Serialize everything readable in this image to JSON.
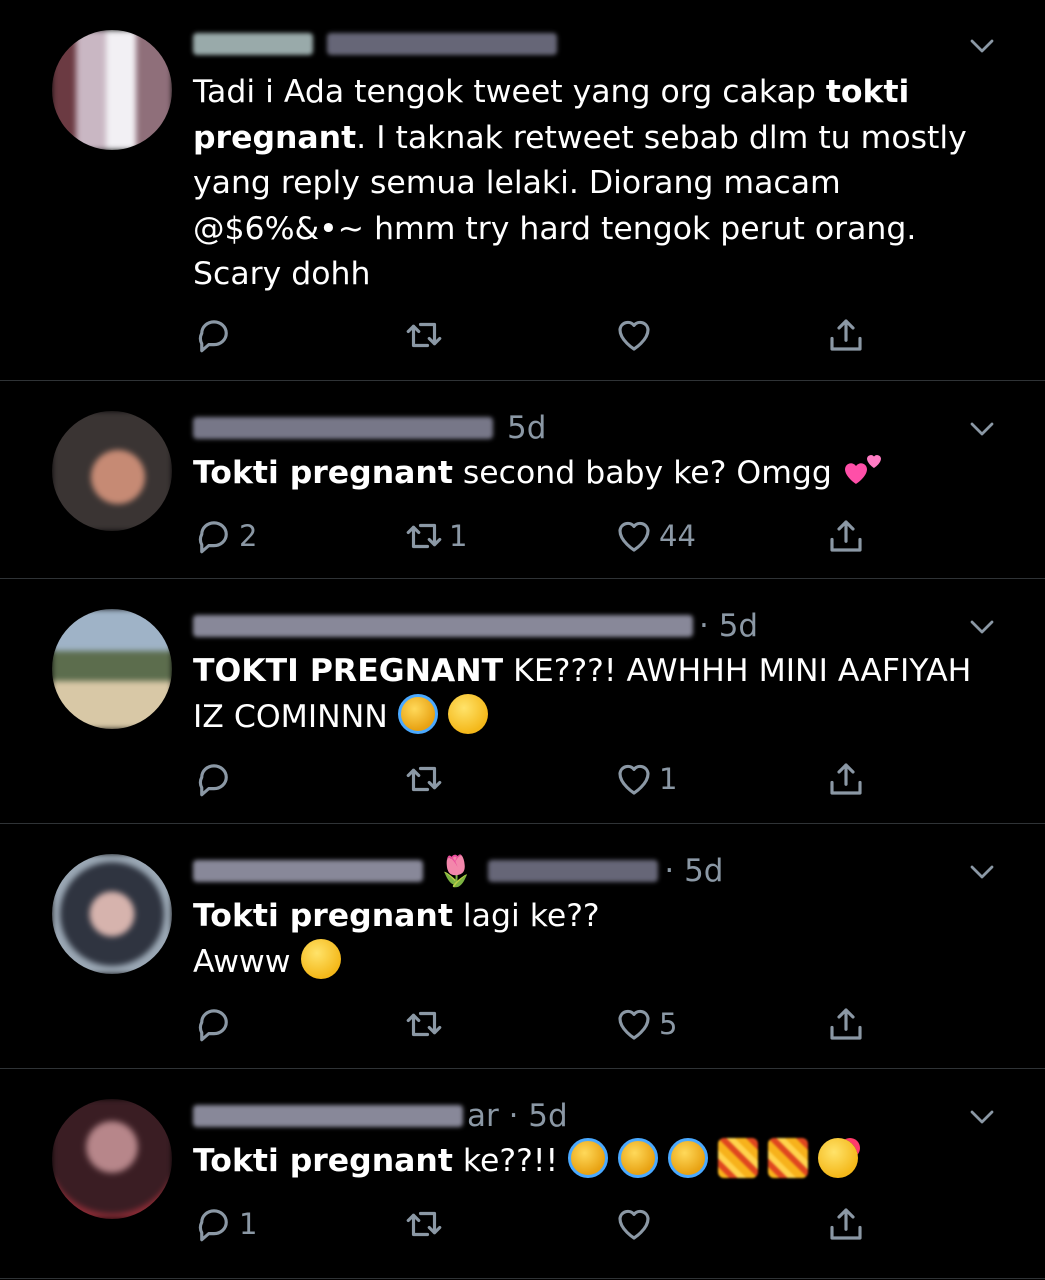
{
  "tweets": [
    {
      "handle_redacted": true,
      "time": "",
      "text_parts": [
        {
          "t": "Tadi i Ada tengok tweet yang org cakap ",
          "b": false
        },
        {
          "t": "tokti pregnant",
          "b": true
        },
        {
          "t": ".  I taknak retweet sebab dlm tu mostly yang reply semua lelaki. Diorang macam @$6%&•~ hmm try hard tengok perut orang. Scary dohh",
          "b": false
        }
      ],
      "replies": "",
      "retweets": "",
      "likes": ""
    },
    {
      "time": "5d",
      "text_parts": [
        {
          "t": "Tokti pregnant",
          "b": true
        },
        {
          "t": " second baby ke? Omgg ",
          "b": false
        }
      ],
      "emojis": [
        "two-hearts"
      ],
      "replies": "2",
      "retweets": "1",
      "likes": "44"
    },
    {
      "time": "· 5d",
      "text_parts": [
        {
          "t": "TOKTI PREGNANT",
          "b": true
        },
        {
          "t": " KE???! AWHHH MINI AAFIYAH IZ COMINNN ",
          "b": false
        }
      ],
      "emojis": [
        "loudly-crying",
        "pleading"
      ],
      "replies": "",
      "retweets": "",
      "likes": "1"
    },
    {
      "time": "· 5d",
      "name_emoji": "🌷",
      "text_parts": [
        {
          "t": "Tokti pregnant",
          "b": true
        },
        {
          "t": " lagi ke??",
          "b": false
        }
      ],
      "line2": "Awww",
      "emojis": [
        "pleading"
      ],
      "replies": "",
      "retweets": "",
      "likes": "5"
    },
    {
      "time": "ar · 5d",
      "text_parts": [
        {
          "t": "Tokti pregnant",
          "b": true
        },
        {
          "t": " ke??!! ",
          "b": false
        }
      ],
      "emojis": [
        "loudly-crying",
        "loudly-crying",
        "loudly-crying",
        "pixelated",
        "pixelated",
        "smiling-with-hearts"
      ],
      "replies": "1",
      "retweets": "",
      "likes": ""
    }
  ],
  "colors": {
    "background": "#000000",
    "text": "#ffffff",
    "muted": "#8b98a5",
    "divider": "#2f3336"
  },
  "icons": [
    "reply-icon",
    "retweet-icon",
    "like-icon",
    "share-icon",
    "chevron-down-icon"
  ]
}
